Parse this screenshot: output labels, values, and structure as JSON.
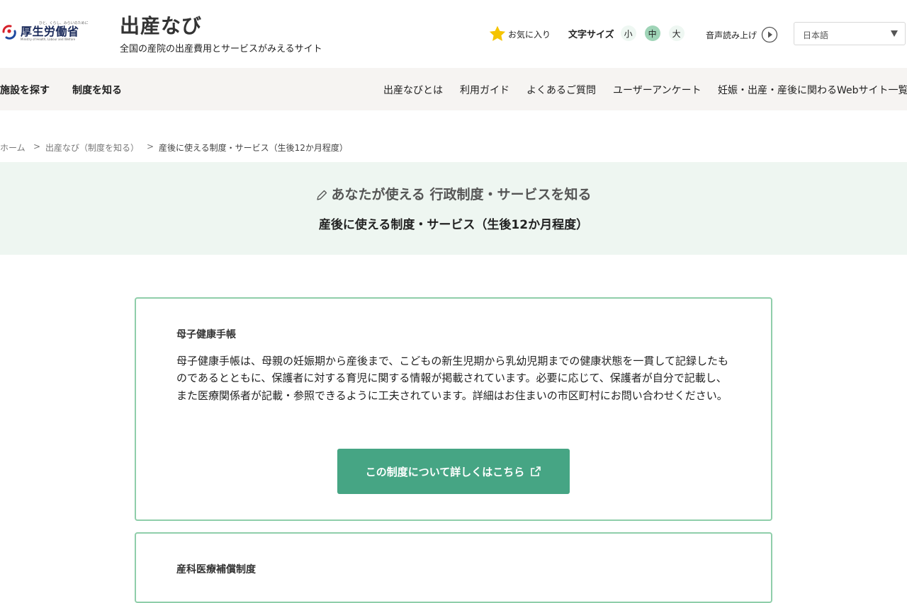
{
  "header": {
    "logo": {
      "tagline": "ひと、くらし、みらいのために",
      "name": "厚生労働省",
      "english": "Ministry of Health, Labour and Welfare"
    },
    "site_title": "出産なび",
    "site_subtitle": "全国の産院の出産費用とサービスがみえるサイト",
    "favorite_label": "お気に入り",
    "font_size": {
      "label": "文字サイズ",
      "options": [
        "小",
        "中",
        "大"
      ],
      "selected": "中"
    },
    "read_aloud_label": "音声読み上げ",
    "language": {
      "selected": "日本語"
    },
    "colors": {
      "accent": "#46a584",
      "star": "#f5c400"
    }
  },
  "nav": {
    "left": [
      "施設を探す",
      "制度を知る"
    ],
    "right": [
      "出産なびとは",
      "利用ガイド",
      "よくあるご質問",
      "ユーザーアンケート",
      "妊娠・出産・産後に関わるWebサイト一覧"
    ]
  },
  "breadcrumb": {
    "items": [
      "ホーム",
      "出産なび（制度を知る）",
      "産後に使える制度・サービス（生後12か月程度）"
    ],
    "separator": ">"
  },
  "hero": {
    "kicker": "あなたが使える 行政制度・サービスを知る",
    "title": "産後に使える制度・サービス（生後12か月程度）"
  },
  "cards": [
    {
      "title": "母子健康手帳",
      "body": "母子健康手帳は、母親の妊娠期から産後まで、こどもの新生児期から乳幼児期までの健康状態を一貫して記録したものであるとともに、保護者に対する育児に関する情報が掲載されています。必要に応じて、保護者が自分で記載し、また医療関係者が記載・参照できるように工夫されています。詳細はお住まいの市区町村にお問い合わせください。",
      "button_label": "この制度について詳しくはこちら"
    },
    {
      "title": "産科医療補償制度"
    }
  ]
}
